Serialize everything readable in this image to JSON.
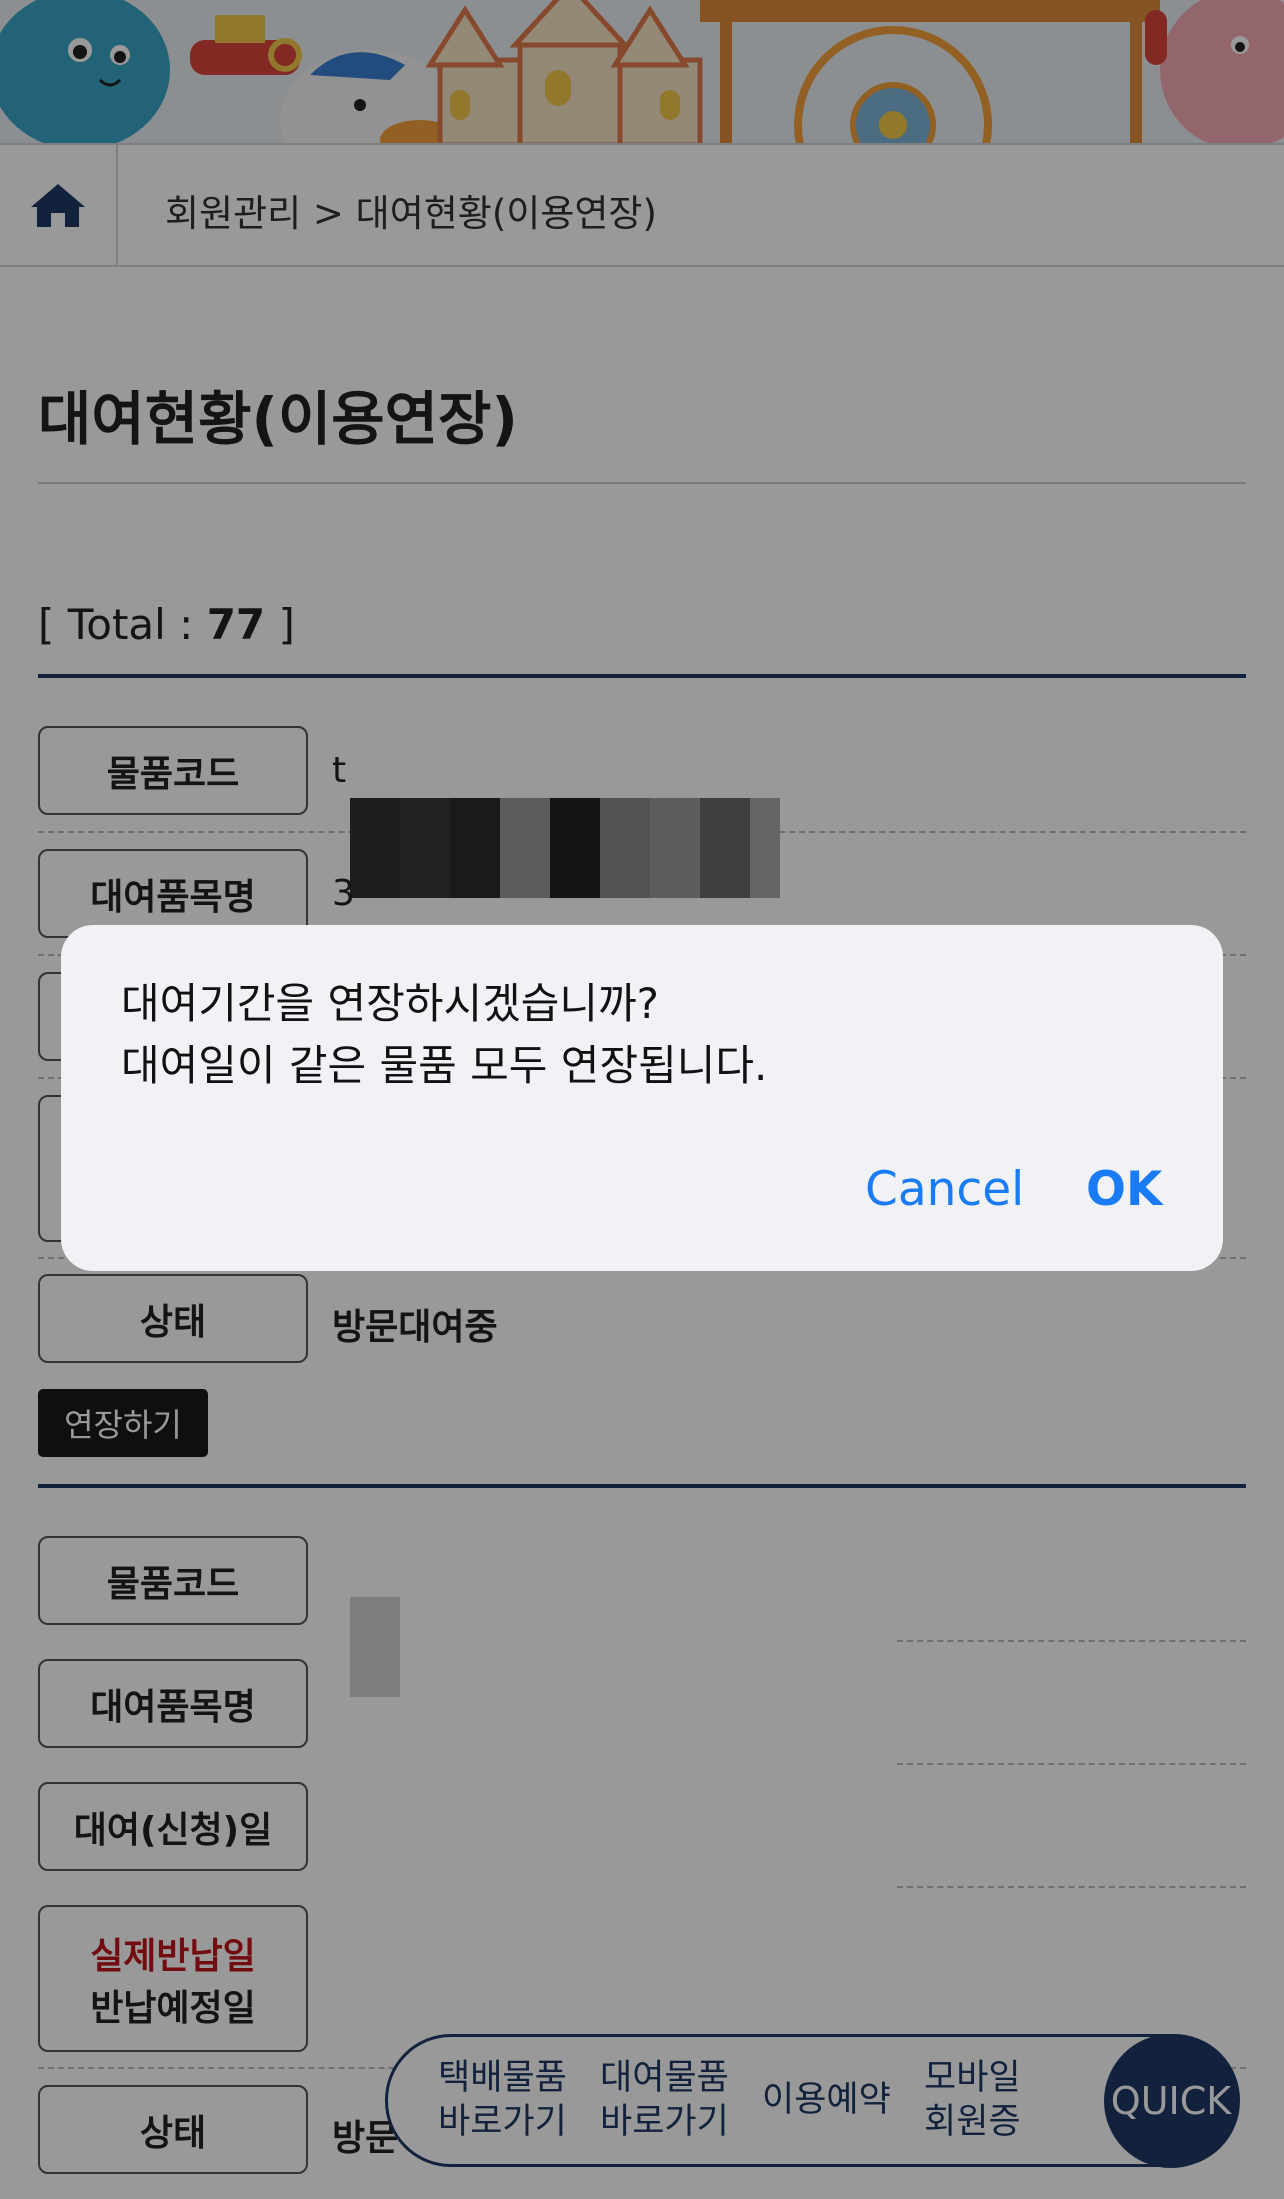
{
  "breadcrumb": {
    "path": "회원관리 > 대여현황(이용연장)"
  },
  "page": {
    "title": "대여현황(이용연장)"
  },
  "total": {
    "prefix": "[ Total : ",
    "count": "77",
    "suffix": " ]"
  },
  "labels": {
    "item_code": "물품코드",
    "item_name": "대여품목명",
    "rental_date": "대여(신청)일",
    "actual_return": "실제반납일",
    "planned_return": "반납예정일",
    "status": "상태"
  },
  "record1": {
    "item_code": "t",
    "item_name": "3",
    "status": "방문대여중"
  },
  "record2": {
    "status": "방문"
  },
  "extend_button": "연장하기",
  "quick_menu": {
    "items": [
      {
        "line1": "택배물품",
        "line2": "바로가기"
      },
      {
        "line1": "대여물품",
        "line2": "바로가기"
      },
      {
        "line1": "이용예약",
        "line2": ""
      },
      {
        "line1": "모바일",
        "line2": "회원증"
      }
    ],
    "toggle": "QUICK"
  },
  "dialog": {
    "message": "대여기간을 연장하시겠습니까?\n대여일이 같은 물품 모두 연장됩니다.",
    "cancel": "Cancel",
    "ok": "OK"
  },
  "colors": {
    "navy": "#1f3a66",
    "link_blue": "#1a7cf5",
    "alert_red": "#c0141c"
  },
  "icons": [
    "home-icon"
  ]
}
